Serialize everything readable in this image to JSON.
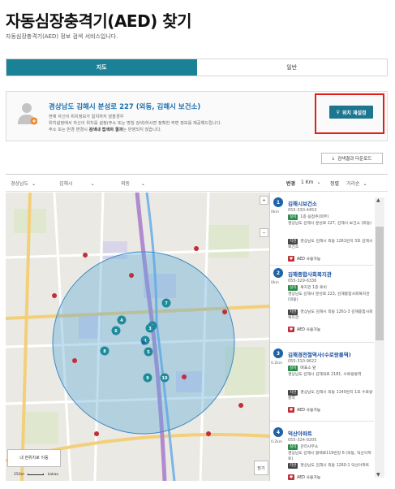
{
  "page": {
    "title": "자동심장충격기(AED) 찾기",
    "subtitle": "자동심장충격기(AED) 정보 검색 서비스입니다."
  },
  "tabs": [
    {
      "label": "지도",
      "active": true
    },
    {
      "label": "일반",
      "active": false
    }
  ],
  "location": {
    "address": "경상남도 김해시 분성로 227 (외동, 김해시 보건소)",
    "desc_line1": "현재 자신이 위치정보가 일치하지 않을경우",
    "desc_line2": "위치설정에서 자신이 위치를 설정(주소 또는 명칭 검색)하시면 정확한 주변 정보를 제공해드립니다.",
    "desc_line3_pre": "주소 또는 반경 변경시",
    "desc_line3_bold": "검색내 접색의 결과",
    "desc_line3_post": "는 반영되지 않습니다.",
    "reset_button": "위치 재설정"
  },
  "download_button": "검색결과 다운로드",
  "filters": {
    "province": "경상남도",
    "city": "김해시",
    "dong": "외동",
    "radius_label": "반경",
    "radius_value": "1 Km",
    "sort_label": "정렬",
    "sort_value": "거리순"
  },
  "map": {
    "current_location_button": "내 현위치로 이동",
    "close_button": "닫기",
    "scale": "250m",
    "brand": "kakao",
    "zoom_in": "+",
    "zoom_out": "−",
    "pins": [
      "1",
      "2",
      "3",
      "4",
      "5",
      "6",
      "7",
      "8",
      "9",
      "10"
    ]
  },
  "results": [
    {
      "num": "1",
      "name": "김해시보건소",
      "phone": "055-330-4453",
      "dist": "0km",
      "loc_tag": "실지",
      "loc_text": "1층 응접주(외부)",
      "road_addr": "경상남도 김해시 분성로 227, 김해시 보건소 (외동)",
      "jibun_tag": "지번",
      "jibun_addr": "경상남도 김해시 외동 1261번지 3호 김해시 보건소",
      "aed_label": "AED 사용가능"
    },
    {
      "num": "2",
      "name": "김해종합사회복지관",
      "phone": "055-329-6336",
      "dist": "0km",
      "loc_tag": "실지",
      "loc_text": "복지관 1층 로비",
      "road_addr": "경상남도 김해시 분성로 223, 김해종합사회복지관 (외동)",
      "jibun_tag": "지번",
      "jibun_addr": "경상남도 김해시 외동 1261-3 김해종합사회복지관",
      "aed_label": "AED 사용가능"
    },
    {
      "num": "3",
      "name": "김해경전철역사(수로왕릉역)",
      "phone": "055-310-9622",
      "dist": "0.2km",
      "loc_tag": "실지",
      "loc_text": "매표소 앞",
      "road_addr": "경상남도 김해시 김해대로 2181, 수로왕릉역",
      "jibun_tag": "지번",
      "jibun_addr": "경상남도 김해시 외동 1140번지 1호 수로왕릉역",
      "aed_label": "AED 사용가능"
    },
    {
      "num": "4",
      "name": "덕산아파트",
      "phone": "055-324-9205",
      "dist": "0.2km",
      "loc_tag": "실지",
      "loc_text": "관리사무소",
      "road_addr": "경상남도 김해시 활백로119번길 6 (외동, 덕산아파트)",
      "jibun_tag": "지번",
      "jibun_addr": "경상남도 김해시 외동 1260-1 덕산아파트",
      "aed_label": "AED 사용가능"
    }
  ],
  "colors": {
    "accent": "#1a8196",
    "link": "#1a4fa0",
    "badge": "#1d63a8",
    "highlight": "#e0201b",
    "circle": "#5aa8d8"
  }
}
